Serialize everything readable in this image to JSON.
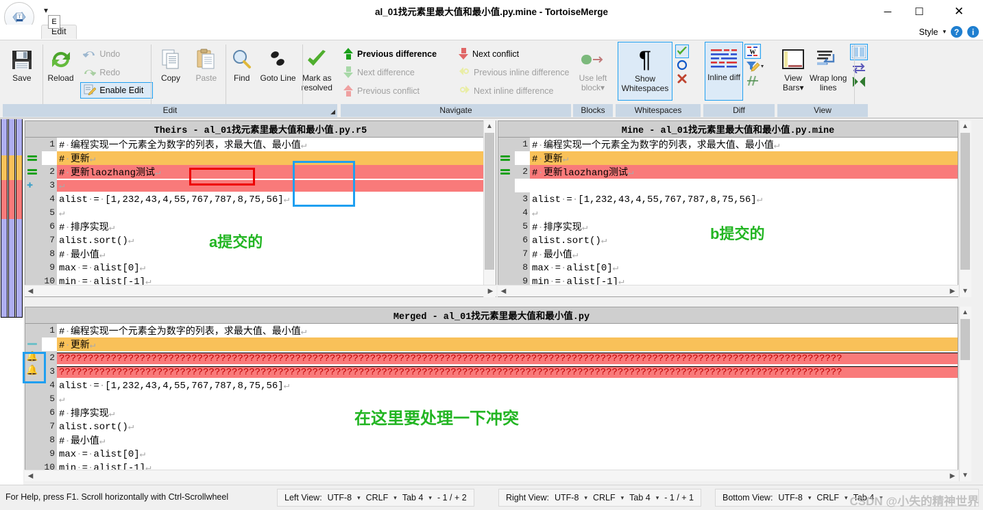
{
  "window": {
    "title": "al_01找元素里最大值和最小值.py.mine - TortoiseMerge",
    "minimize": "─",
    "maximize": "☐",
    "close": "✕",
    "qat_caret": "▾",
    "app_icon": "T"
  },
  "ribbon": {
    "tab": "Edit",
    "keytip": "E",
    "style_label": "Style",
    "style_caret": "▾",
    "help_icon": "?",
    "info_icon": "i",
    "groups": {
      "edit": {
        "caption": "Edit",
        "save": "Save",
        "reload": "Reload",
        "undo": "Undo",
        "redo": "Redo",
        "enable_edit": "Enable Edit",
        "copy": "Copy",
        "paste": "Paste",
        "find": "Find",
        "goto_line": "Goto Line",
        "mark_as_resolved": "Mark as resolved"
      },
      "navigate": {
        "caption": "Navigate",
        "previous_difference": "Previous difference",
        "next_difference": "Next difference",
        "previous_conflict": "Previous conflict",
        "next_conflict": "Next conflict",
        "previous_inline_difference": "Previous inline difference",
        "next_inline_difference": "Next inline difference"
      },
      "blocks": {
        "caption": "Blocks",
        "use_left_block": "Use left block",
        "caret": "▾"
      },
      "whitespaces": {
        "caption": "Whitespaces",
        "show_whitespaces": "Show Whitespaces",
        "pilcrow": "¶"
      },
      "diff": {
        "caption": "Diff",
        "inline_diff": "Inline diff",
        "caret": "▾"
      },
      "view": {
        "caption": "View",
        "view_bars": "View Bars",
        "view_bars_caret": "▾",
        "wrap_long_lines": "Wrap long lines"
      }
    }
  },
  "panes": {
    "theirs": {
      "title": "Theirs - al_01找元素里最大值和最小值.py.r5",
      "lines": [
        {
          "num": "1",
          "text": "#·编程实现一个元素全为数字的列表，求最大值、最小值",
          "state": "norm",
          "mark": "",
          "eol": "↵"
        },
        {
          "num": "",
          "text": "#·更新",
          "state": "yel",
          "mark": "equal",
          "eol": "↵"
        },
        {
          "num": "2",
          "text": "#·更新laozhang测试",
          "state": "red",
          "mark": "equal",
          "eol": "↵"
        },
        {
          "num": "3",
          "text": "",
          "state": "red",
          "mark": "plus",
          "eol": "↵"
        },
        {
          "num": "4",
          "text": "alist·=·[1,232,43,4,55,767,787,8,75,56]",
          "state": "norm",
          "mark": "",
          "eol": "↵"
        },
        {
          "num": "5",
          "text": "",
          "state": "norm",
          "mark": "",
          "eol": "↵"
        },
        {
          "num": "6",
          "text": "#·排序实现",
          "state": "norm",
          "mark": "",
          "eol": "↵"
        },
        {
          "num": "7",
          "text": "alist.sort()",
          "state": "norm",
          "mark": "",
          "eol": "↵"
        },
        {
          "num": "8",
          "text": "#·最小值",
          "state": "norm",
          "mark": "",
          "eol": "↵"
        },
        {
          "num": "9",
          "text": "max·=·alist[0]",
          "state": "norm",
          "mark": "",
          "eol": "↵"
        },
        {
          "num": "10",
          "text": "min·=·alist[-1]",
          "state": "norm",
          "mark": "",
          "eol": "↵"
        }
      ],
      "annotation": "a提交的"
    },
    "mine": {
      "title": "Mine - al_01找元素里最大值和最小值.py.mine",
      "lines": [
        {
          "num": "1",
          "text": "#·编程实现一个元素全为数字的列表，求最大值、最小值",
          "state": "norm",
          "mark": "",
          "eol": "↵"
        },
        {
          "num": "",
          "text": "#·更新",
          "state": "yel",
          "mark": "equal",
          "eol": "↵"
        },
        {
          "num": "2",
          "text": "#·更新laozhang测试",
          "state": "red",
          "mark": "equal",
          "eol": "↵"
        },
        {
          "num": "",
          "text": "",
          "state": "red",
          "mark": "",
          "eol": ""
        },
        {
          "num": "3",
          "text": "alist·=·[1,232,43,4,55,767,787,8,75,56]",
          "state": "norm",
          "mark": "",
          "eol": "↵"
        },
        {
          "num": "4",
          "text": "",
          "state": "norm",
          "mark": "",
          "eol": "↵"
        },
        {
          "num": "5",
          "text": "#·排序实现",
          "state": "norm",
          "mark": "",
          "eol": "↵"
        },
        {
          "num": "6",
          "text": "alist.sort()",
          "state": "norm",
          "mark": "",
          "eol": "↵"
        },
        {
          "num": "7",
          "text": "#·最小值",
          "state": "norm",
          "mark": "",
          "eol": "↵"
        },
        {
          "num": "8",
          "text": "max·=·alist[0]",
          "state": "norm",
          "mark": "",
          "eol": "↵"
        },
        {
          "num": "9",
          "text": "min·=·alist[-1]",
          "state": "norm",
          "mark": "",
          "eol": "↵"
        }
      ],
      "annotation": "b提交的"
    },
    "merged": {
      "title": "Merged - al_01找元素里最大值和最小值.py",
      "lines": [
        {
          "num": "1",
          "text": "#·编程实现一个元素全为数字的列表，求最大值、最小值",
          "state": "norm",
          "mark": "",
          "eol": "↵"
        },
        {
          "num": "",
          "text": "#·更新",
          "state": "yel",
          "mark": "dash",
          "eol": "↵"
        },
        {
          "num": "2",
          "text": "????????????????????????????????????????????????????????????????????????????????????????????????????????????????????????????????????????",
          "state": "confl",
          "mark": "bell",
          "eol": ""
        },
        {
          "num": "3",
          "text": "????????????????????????????????????????????????????????????????????????????????????????????????????????????????????????????????????????",
          "state": "confl",
          "mark": "bell",
          "eol": ""
        },
        {
          "num": "4",
          "text": "alist·=·[1,232,43,4,55,767,787,8,75,56]",
          "state": "norm",
          "mark": "",
          "eol": "↵"
        },
        {
          "num": "5",
          "text": "",
          "state": "norm",
          "mark": "",
          "eol": "↵"
        },
        {
          "num": "6",
          "text": "#·排序实现",
          "state": "norm",
          "mark": "",
          "eol": "↵"
        },
        {
          "num": "7",
          "text": "alist.sort()",
          "state": "norm",
          "mark": "",
          "eol": "↵"
        },
        {
          "num": "8",
          "text": "#·最小值",
          "state": "norm",
          "mark": "",
          "eol": "↵"
        },
        {
          "num": "9",
          "text": "max·=·alist[0]",
          "state": "norm",
          "mark": "",
          "eol": "↵"
        },
        {
          "num": "10",
          "text": "min·=·alist[-1]",
          "state": "norm",
          "mark": "",
          "eol": "↵"
        }
      ],
      "annotation": "在这里要处理一下冲突"
    }
  },
  "status": {
    "help_text": "For Help, press F1. Scroll horizontally with Ctrl-Scrollwheel",
    "left": {
      "label": "Left View:",
      "encoding": "UTF-8",
      "eol": "CRLF",
      "tab": "Tab 4",
      "counts": "- 1 / + 2"
    },
    "right": {
      "label": "Right View:",
      "encoding": "UTF-8",
      "eol": "CRLF",
      "tab": "Tab 4",
      "counts": "- 1 / + 1"
    },
    "bottom": {
      "label": "Bottom View:",
      "encoding": "UTF-8",
      "eol": "CRLF",
      "tab": "Tab 4",
      "counts": ""
    },
    "caret": "▾"
  },
  "watermark": "CSDN @小失的精神世界",
  "colors": {
    "conflict_red": "#f97a7a",
    "changed_yellow": "#f9c159",
    "annotation_green": "#22b522",
    "box_red": "#ee0000",
    "box_blue": "#1f9ff0",
    "group_caption": "#c9d7e5"
  }
}
